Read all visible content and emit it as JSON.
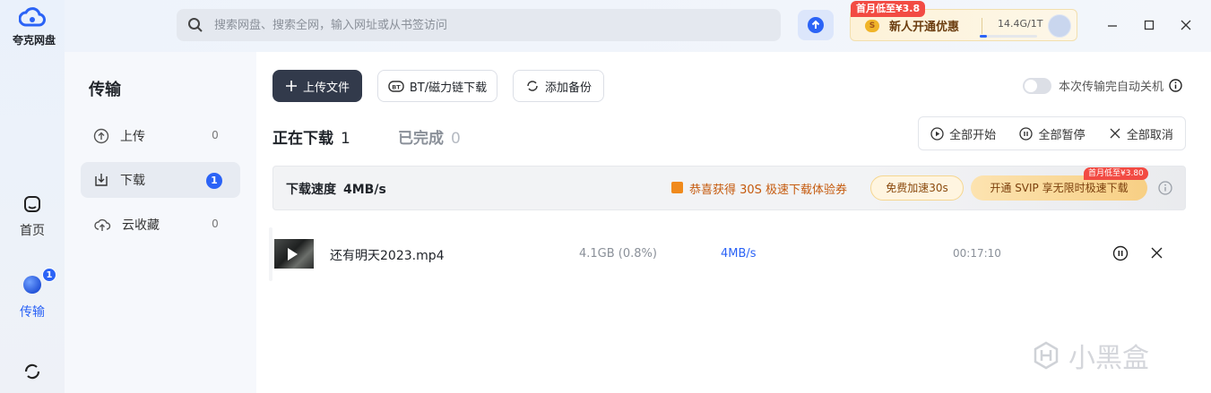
{
  "app": {
    "logo_text": "夸克网盘"
  },
  "search": {
    "placeholder": "搜索网盘、搜索全网，输入网址或从书签访问"
  },
  "vip": {
    "promo_tag": "首月低至¥3.8",
    "offer_text": "新人开通优惠",
    "coin_symbol": "S",
    "storage_text": "14.4G/1T",
    "storage_used_fraction": 0.014
  },
  "rail": {
    "items": [
      {
        "label": "首页",
        "icon": "home-icon"
      },
      {
        "label": "传输",
        "icon": "transfer-icon",
        "badge": "1"
      },
      {
        "label": "",
        "icon": "sync-icon"
      }
    ]
  },
  "sidebar": {
    "title": "传输",
    "items": [
      {
        "label": "上传",
        "count": "0",
        "icon": "upload-circle-icon"
      },
      {
        "label": "下载",
        "count": "1",
        "icon": "download-tray-icon"
      },
      {
        "label": "云收藏",
        "count": "0",
        "icon": "cloud-upload-icon"
      }
    ]
  },
  "toolbar": {
    "upload_label": "上传文件",
    "bt_label": "BT/磁力链下载",
    "backup_label": "添加备份",
    "auto_shutdown_label": "本次传输完自动关机"
  },
  "tabs": {
    "downloading_label": "正在下载",
    "downloading_count": "1",
    "completed_label": "已完成",
    "completed_count": "0"
  },
  "controls": {
    "start_all": "全部开始",
    "pause_all": "全部暂停",
    "cancel_all": "全部取消"
  },
  "speed_bar": {
    "label": "下载速度",
    "value": "4MB/s",
    "coupon_text": "恭喜获得 30S 极速下载体验券",
    "accel_button": "免费加速30s",
    "svip_button": "开通 SVIP 享无限时极速下载",
    "svip_tag": "首月低至¥3.80"
  },
  "downloads": [
    {
      "name": "还有明天2023.mp4",
      "size": "4.1GB (0.8%)",
      "speed": "4MB/s",
      "time": "00:17:10"
    }
  ],
  "watermark": {
    "text": "小黑盒"
  },
  "colors": {
    "accent": "#2b63f6",
    "dark_button": "#323a4b",
    "promo_red": "#f24b43"
  }
}
